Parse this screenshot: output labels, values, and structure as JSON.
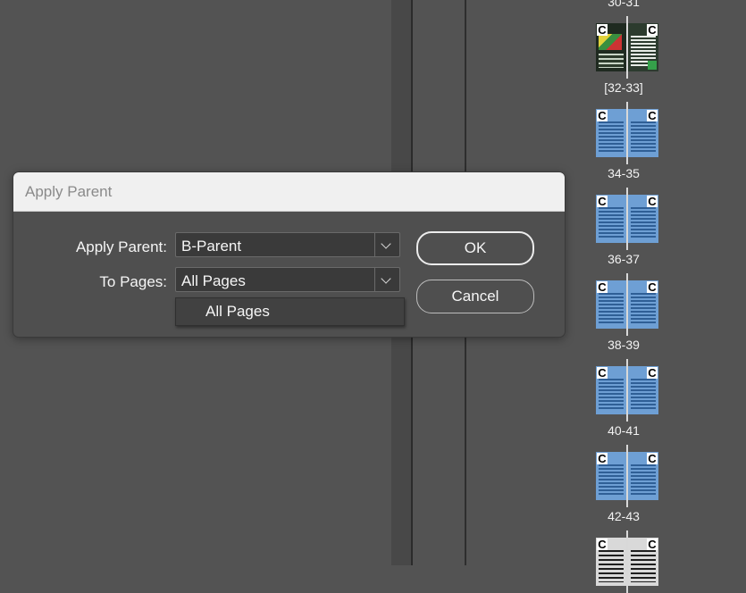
{
  "dialog": {
    "title": "Apply Parent",
    "apply_parent_label": "Apply Parent:",
    "apply_parent_value": "B-Parent",
    "to_pages_label": "To Pages:",
    "to_pages_value": "All Pages",
    "dropdown_options": [
      "All Pages"
    ],
    "ok_label": "OK",
    "cancel_label": "Cancel"
  },
  "pages_panel": {
    "spread_labels": [
      "30-31",
      "[32-33]",
      "34-35",
      "36-37",
      "38-39",
      "40-41",
      "42-43"
    ],
    "parent_letter": "C"
  }
}
